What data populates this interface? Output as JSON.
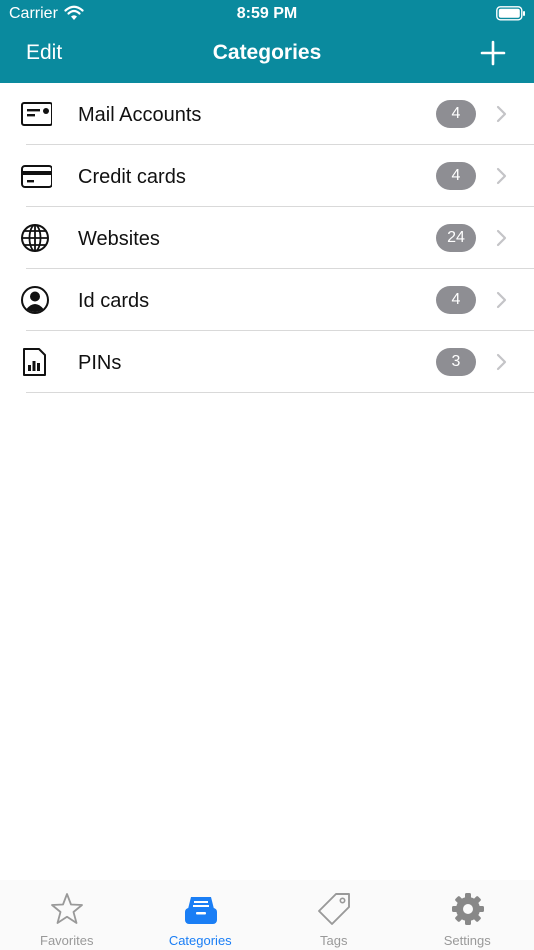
{
  "status_bar": {
    "carrier": "Carrier",
    "time": "8:59 PM"
  },
  "nav": {
    "edit_label": "Edit",
    "title": "Categories"
  },
  "categories": [
    {
      "label": "Mail Accounts",
      "count": "4",
      "icon": "mail-card-icon"
    },
    {
      "label": "Credit cards",
      "count": "4",
      "icon": "credit-card-icon"
    },
    {
      "label": "Websites",
      "count": "24",
      "icon": "globe-icon"
    },
    {
      "label": "Id cards",
      "count": "4",
      "icon": "person-circle-icon"
    },
    {
      "label": "PINs",
      "count": "3",
      "icon": "sim-card-icon"
    }
  ],
  "tabs": [
    {
      "label": "Favorites",
      "icon": "star-icon",
      "active": false
    },
    {
      "label": "Categories",
      "icon": "tray-icon",
      "active": true
    },
    {
      "label": "Tags",
      "icon": "tag-icon",
      "active": false
    },
    {
      "label": "Settings",
      "icon": "gear-icon",
      "active": false
    }
  ],
  "colors": {
    "header": "#0a8a9e",
    "badge": "#8e8e93",
    "active_tab": "#1a7ef5",
    "inactive_tab": "#999999"
  }
}
